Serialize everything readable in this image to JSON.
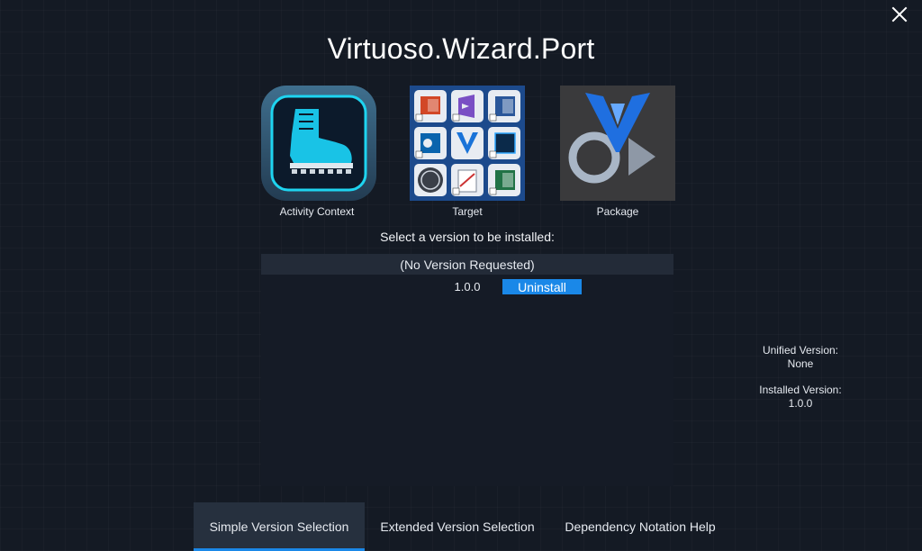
{
  "window": {
    "title": "Virtuoso.Wizard.Port"
  },
  "tiles": [
    {
      "label": "Activity Context",
      "icon": "boot-icon"
    },
    {
      "label": "Target",
      "icon": "office-apps-grid-icon"
    },
    {
      "label": "Package",
      "icon": "package-logo-icon"
    }
  ],
  "prompt": "Select a version to be installed:",
  "versions": {
    "header": "(No Version Requested)",
    "rows": [
      {
        "version": "1.0.0",
        "action_label": "Uninstall"
      }
    ]
  },
  "info": {
    "unified_label": "Unified Version:",
    "unified_value": "None",
    "installed_label": "Installed Version:",
    "installed_value": "1.0.0"
  },
  "tabs": [
    {
      "label": "Simple Version Selection",
      "active": true
    },
    {
      "label": "Extended Version Selection",
      "active": false
    },
    {
      "label": "Dependency Notation Help",
      "active": false
    }
  ],
  "colors": {
    "accent": "#1a88e8",
    "background": "#141a24",
    "panel": "#151b26",
    "header": "#232b38"
  }
}
